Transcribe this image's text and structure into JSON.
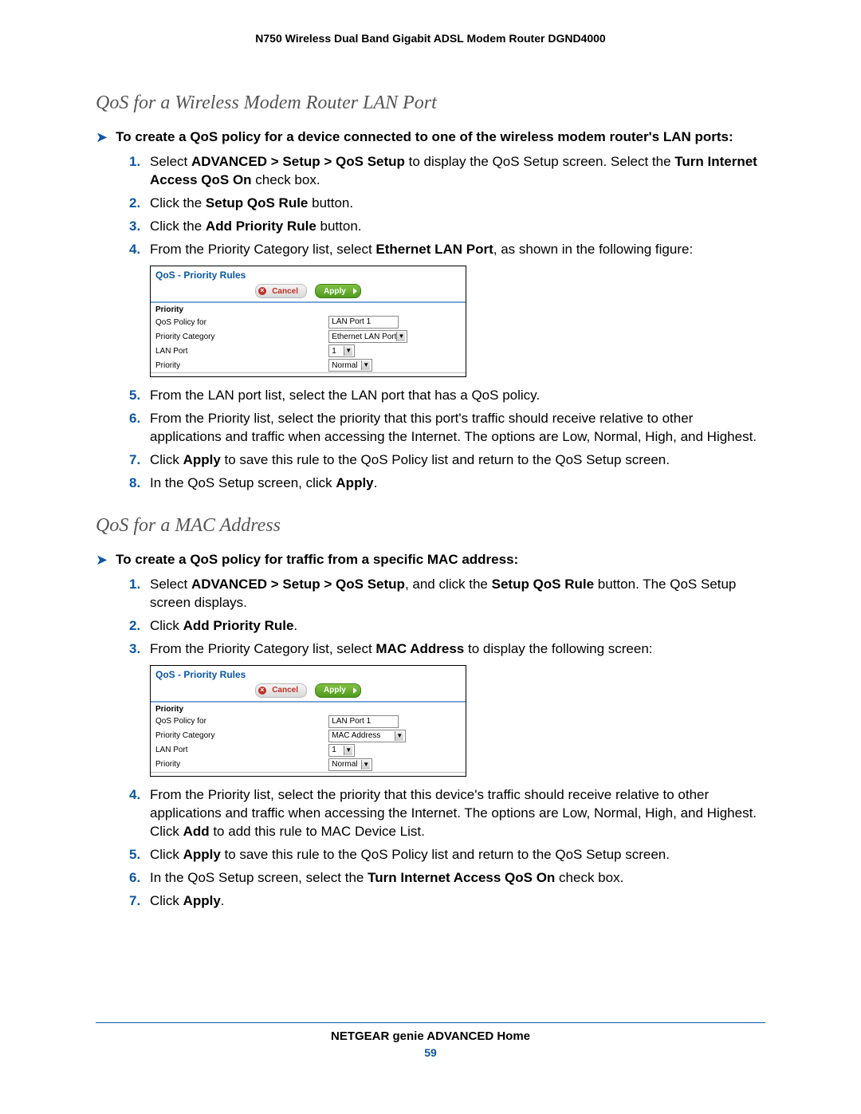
{
  "doc_header": "N750 Wireless Dual Band Gigabit ADSL Modem Router DGND4000",
  "section1": {
    "title": "QoS for a Wireless Modem Router LAN Port",
    "intro": "To create a QoS policy for a device connected to one of the wireless modem router's LAN ports:",
    "steps": {
      "s1a": "Select ",
      "s1b": "ADVANCED > Setup > QoS Setup",
      "s1c": " to display the QoS Setup screen. Select the ",
      "s1d": "Turn Internet Access QoS On",
      "s1e": " check box.",
      "s2a": "Click the ",
      "s2b": "Setup QoS Rule",
      "s2c": " button.",
      "s3a": "Click the ",
      "s3b": "Add Priority Rule",
      "s3c": " button.",
      "s4a": "From the Priority Category list, select ",
      "s4b": "Ethernet LAN Port",
      "s4c": ", as shown in the following figure:",
      "s5": "From the LAN port list, select the LAN port that has a QoS policy.",
      "s6": "From the Priority list, select the priority that this port's traffic should receive relative to other applications and traffic when accessing the Internet. The options are Low, Normal, High, and Highest.",
      "s7a": "Click ",
      "s7b": "Apply",
      "s7c": " to save this rule to the QoS Policy list and return to the QoS Setup screen.",
      "s8a": "In the QoS Setup screen, click ",
      "s8b": "Apply",
      "s8c": "."
    }
  },
  "section2": {
    "title": "QoS for a MAC Address",
    "intro": "To create a QoS policy for traffic from a specific MAC address:",
    "steps": {
      "s1a": "Select ",
      "s1b": "ADVANCED > Setup > QoS Setup",
      "s1c": ", and click the ",
      "s1d": "Setup QoS Rule",
      "s1e": " button. The QoS Setup screen displays.",
      "s2a": "Click ",
      "s2b": "Add Priority Rule",
      "s2c": ".",
      "s3a": "From the Priority Category list, select ",
      "s3b": "MAC Address",
      "s3c": " to display the following screen:",
      "s4a": "From the Priority list, select the priority that this device's traffic should receive relative to other applications and traffic when accessing the Internet. The options are Low, Normal, High, and Highest. Click ",
      "s4b": "Add",
      "s4c": " to add this rule to MAC Device List.",
      "s5a": "Click ",
      "s5b": "Apply",
      "s5c": " to save this rule to the QoS Policy list and return to the QoS Setup screen.",
      "s6a": "In the QoS Setup screen, select the ",
      "s6b": "Turn Internet Access QoS On",
      "s6c": " check box.",
      "s7a": "Click ",
      "s7b": "Apply",
      "s7c": "."
    }
  },
  "shot": {
    "title": "QoS - Priority Rules",
    "cancel": "Cancel",
    "apply": "Apply",
    "priority_header": "Priority",
    "rows": {
      "qos_policy_for": "QoS Policy for",
      "priority_category": "Priority Category",
      "lan_port": "LAN Port",
      "priority": "Priority"
    },
    "vals": {
      "lanport1": "LAN Port 1",
      "ethernet_lan_port": "Ethernet LAN Port",
      "mac_address": "MAC Address",
      "one": "1",
      "normal": "Normal"
    }
  },
  "footer": {
    "title": "NETGEAR genie ADVANCED Home",
    "page": "59"
  }
}
